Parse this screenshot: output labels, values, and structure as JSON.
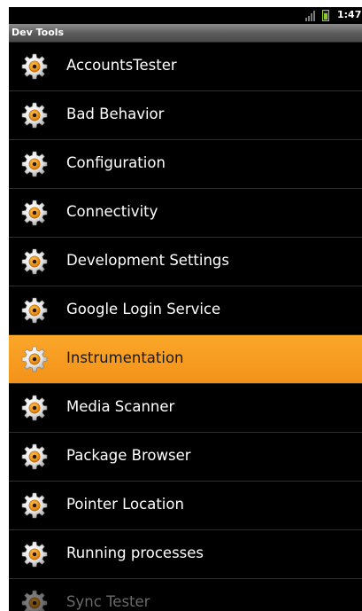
{
  "status_bar": {
    "time": "1:47",
    "signal_icon": "signal-bars-icon",
    "battery_icon": "battery-charging-icon"
  },
  "title_bar": {
    "title": "Dev Tools"
  },
  "list": {
    "item_icon": "settings-gear-icon",
    "selected_color": "#f7a01e",
    "items": [
      {
        "label": "AccountsTester"
      },
      {
        "label": "Bad Behavior"
      },
      {
        "label": "Configuration"
      },
      {
        "label": "Connectivity"
      },
      {
        "label": "Development Settings"
      },
      {
        "label": "Google Login Service"
      },
      {
        "label": "Instrumentation",
        "selected": true
      },
      {
        "label": "Media Scanner"
      },
      {
        "label": "Package Browser"
      },
      {
        "label": "Pointer Location"
      },
      {
        "label": "Running processes"
      },
      {
        "label": "Sync Tester"
      }
    ]
  }
}
